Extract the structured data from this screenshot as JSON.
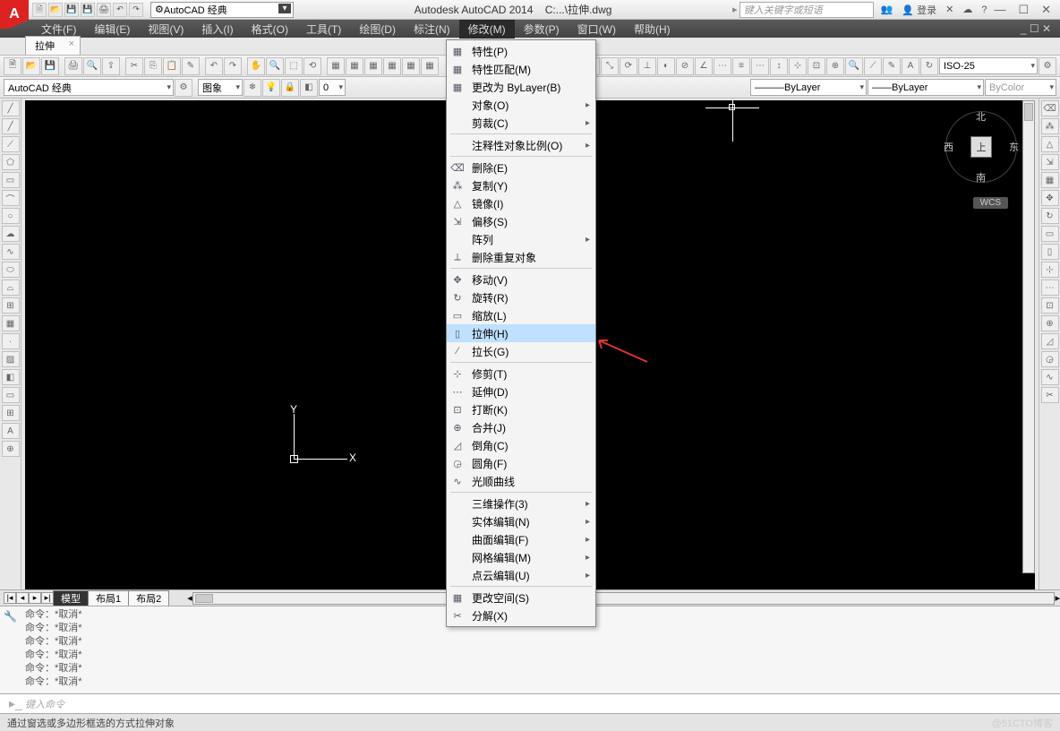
{
  "title": {
    "app": "Autodesk AutoCAD 2014",
    "file": "C:...\\拉伸.dwg"
  },
  "logo": "A",
  "workspace_top": "AutoCAD 经典",
  "search_placeholder": "键入关键字或短语",
  "login": "登录",
  "menubar": [
    "文件(F)",
    "编辑(E)",
    "视图(V)",
    "插入(I)",
    "格式(O)",
    "工具(T)",
    "绘图(D)",
    "标注(N)",
    "修改(M)",
    "参数(P)",
    "窗口(W)",
    "帮助(H)"
  ],
  "menubar_active_index": 8,
  "mdi_tab": "拉伸",
  "row2": {
    "workspace": "AutoCAD 经典",
    "layer_state": "图象",
    "layer_current": "0",
    "bylayer1": "ByLayer",
    "bylayer2": "ByLayer",
    "bycolor": "ByColor",
    "dimstyle": "ISO-25"
  },
  "dropdown": {
    "groups": [
      [
        {
          "i": "▦",
          "t": "特性(P)"
        },
        {
          "i": "▦",
          "t": "特性匹配(M)"
        },
        {
          "i": "▦",
          "t": "更改为 ByLayer(B)"
        },
        {
          "i": "",
          "t": "对象(O)",
          "sub": true
        },
        {
          "i": "",
          "t": "剪裁(C)",
          "sub": true
        }
      ],
      [
        {
          "i": "",
          "t": "注释性对象比例(O)",
          "sub": true
        }
      ],
      [
        {
          "i": "⌫",
          "t": "删除(E)"
        },
        {
          "i": "⁂",
          "t": "复制(Y)"
        },
        {
          "i": "△",
          "t": "镜像(I)"
        },
        {
          "i": "⇲",
          "t": "偏移(S)"
        },
        {
          "i": "",
          "t": "阵列",
          "sub": true
        },
        {
          "i": "⟂",
          "t": "删除重复对象"
        }
      ],
      [
        {
          "i": "✥",
          "t": "移动(V)"
        },
        {
          "i": "↻",
          "t": "旋转(R)"
        },
        {
          "i": "▭",
          "t": "缩放(L)"
        },
        {
          "i": "▯",
          "t": "拉伸(H)",
          "hl": true
        },
        {
          "i": "⁄",
          "t": "拉长(G)"
        }
      ],
      [
        {
          "i": "⊹",
          "t": "修剪(T)"
        },
        {
          "i": "⋯",
          "t": "延伸(D)"
        },
        {
          "i": "⊡",
          "t": "打断(K)"
        },
        {
          "i": "⊕",
          "t": "合并(J)"
        },
        {
          "i": "◿",
          "t": "倒角(C)"
        },
        {
          "i": "◶",
          "t": "圆角(F)"
        },
        {
          "i": "∿",
          "t": "光顺曲线"
        }
      ],
      [
        {
          "i": "",
          "t": "三维操作(3)",
          "sub": true
        },
        {
          "i": "",
          "t": "实体编辑(N)",
          "sub": true
        },
        {
          "i": "",
          "t": "曲面编辑(F)",
          "sub": true
        },
        {
          "i": "",
          "t": "网格编辑(M)",
          "sub": true
        },
        {
          "i": "",
          "t": "点云编辑(U)",
          "sub": true
        }
      ],
      [
        {
          "i": "▦",
          "t": "更改空间(S)"
        },
        {
          "i": "✂",
          "t": "分解(X)"
        }
      ]
    ]
  },
  "viewcube": {
    "top": "上",
    "n": "北",
    "s": "南",
    "e": "东",
    "w": "西",
    "wcs": "WCS"
  },
  "ucs": {
    "x": "X",
    "y": "Y"
  },
  "layout_tabs": {
    "nav": [
      "|◂",
      "◂",
      "▸",
      "▸|"
    ],
    "tabs": [
      "模型",
      "布局1",
      "布局2"
    ],
    "active": 0
  },
  "cmdlog": [
    "命令：*取消*",
    "命令：*取消*",
    "命令：*取消*",
    "命令：*取消*",
    "命令：*取消*",
    "命令：*取消*"
  ],
  "cmd_placeholder": "键入命令",
  "status_text": "通过窗选或多边形框选的方式拉伸对象",
  "watermark": "@51CTO博客"
}
